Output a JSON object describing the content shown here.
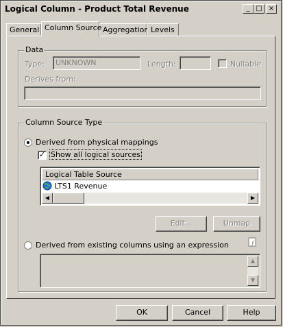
{
  "window": {
    "title": "Logical Column - Product Total Revenue",
    "minimize": "_",
    "maximize": "□",
    "close": "×"
  },
  "tabs": [
    "General",
    "Column Source",
    "Aggregation",
    "Levels"
  ],
  "data_group": {
    "legend": "Data",
    "type_label": "Type:",
    "type_value": "UNKNOWN",
    "length_label": "Length:",
    "length_value": "",
    "nullable_label": "Nullable",
    "derives_label": "Derives from:",
    "derives_value": ""
  },
  "source_group": {
    "legend": "Column Source Type",
    "option_physical": "Derived from physical mappings",
    "show_all_label": "Show all logical sources",
    "table_header": "Logical Table Source",
    "table_rows": [
      "LTS1 Revenue"
    ],
    "edit_button": "Edit...",
    "unmap_button": "Unmap",
    "option_expression": "Derived from existing columns using an expression",
    "expression_value": ""
  },
  "buttons": {
    "ok": "OK",
    "cancel": "Cancel",
    "help": "Help"
  }
}
